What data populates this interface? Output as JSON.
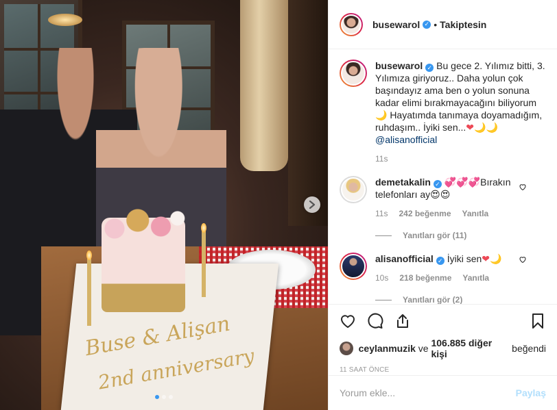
{
  "header": {
    "username": "busewarol",
    "follow_state": "Takiptesin",
    "separator": "•"
  },
  "caption": {
    "username": "busewarol",
    "text": "Bu gece 2. Yılımız bitti, 3. Yılımıza giriyoruz.. Daha yolun çok başındayız ama ben o yolun sonuna kadar elimi bırakmayacağını biliyorum 🌙 Hayatımda tanımaya doyamadığım, ruhdaşım.. İyiki sen...",
    "emoji_tail": "❤🌙🌙",
    "mention": "@alisanofficial",
    "time": "11s"
  },
  "comments": [
    {
      "username": "demetakalin",
      "emoji_lead": "💞💞💞",
      "text": "Bırakın telefonları ay😍😍",
      "time": "11s",
      "likes": "242 beğenme",
      "reply_label": "Yanıtla",
      "view_replies": "Yanıtları gör (11)"
    },
    {
      "username": "alisanofficial",
      "text": "İyiki sen",
      "emoji_tail": "❤🌙",
      "time": "10s",
      "likes": "218 beğenme",
      "reply_label": "Yanıtla",
      "view_replies": "Yanıtları gör (2)"
    }
  ],
  "likes": {
    "first_liker": "ceylanmuzik",
    "connector": "ve",
    "others": "106.885 diğer kişi",
    "suffix": "beğendi"
  },
  "timestamp": "11 SAAT ÖNCE",
  "composer": {
    "placeholder": "Yorum ekle...",
    "share_label": "Paylaş"
  },
  "photo": {
    "inscription_line1": "Buse & Alişan",
    "inscription_line2": "2nd anniversary",
    "carousel_dots": 3,
    "active_dot": 1
  },
  "colors": {
    "accent": "#3897f0",
    "heart": "#ed4956",
    "share_disabled": "#b2dffc",
    "text": "#262626",
    "muted": "#8e8e8e"
  },
  "icons": [
    "heart-icon",
    "comment-icon",
    "share-icon",
    "bookmark-icon",
    "next-arrow-icon",
    "verified-icon",
    "like-small-icon"
  ]
}
